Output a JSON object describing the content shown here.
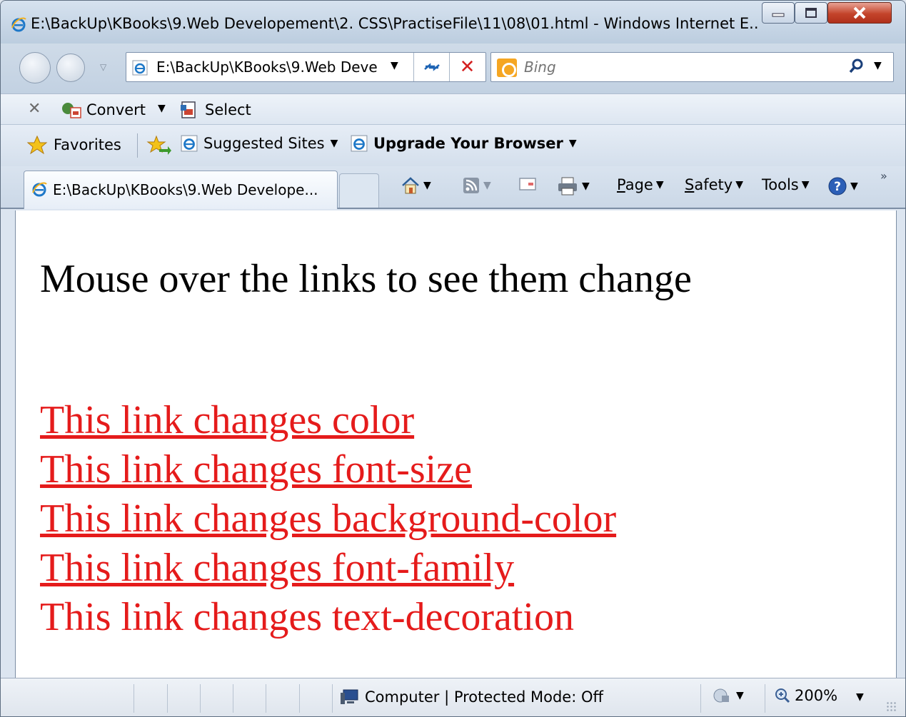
{
  "window": {
    "title": "E:\\BackUp\\KBooks\\9.Web Developement\\2. CSS\\PractiseFile\\11\\08\\01.html - Windows Internet E..."
  },
  "address_bar": {
    "value": "E:\\BackUp\\KBooks\\9.Web Deve"
  },
  "search": {
    "placeholder": "Bing"
  },
  "command_bar": {
    "convert_label": "Convert",
    "select_label": "Select"
  },
  "favorites_bar": {
    "favorites_label": "Favorites",
    "suggested_label": "Suggested Sites",
    "upgrade_label": "Upgrade Your Browser"
  },
  "tab": {
    "label": "E:\\BackUp\\KBooks\\9.Web Develope..."
  },
  "toolbar": {
    "page_label": "Page",
    "safety_label": "Safety",
    "tools_label": "Tools"
  },
  "page": {
    "heading": "Mouse over the links to see them change",
    "links": [
      "This link changes color",
      "This link changes font-size",
      "This link changes background-color",
      "This link changes font-family",
      "This link changes text-decoration"
    ],
    "link_color": "#e51b1b"
  },
  "status_bar": {
    "zone_text": "Computer | Protected Mode: Off",
    "zoom": "200%"
  },
  "icons": {
    "browser": "ie-logo-icon",
    "search": "magnifier-icon",
    "home": "home-icon",
    "feeds": "rss-icon",
    "mail": "mail-icon",
    "print": "printer-icon",
    "help": "help-icon"
  }
}
